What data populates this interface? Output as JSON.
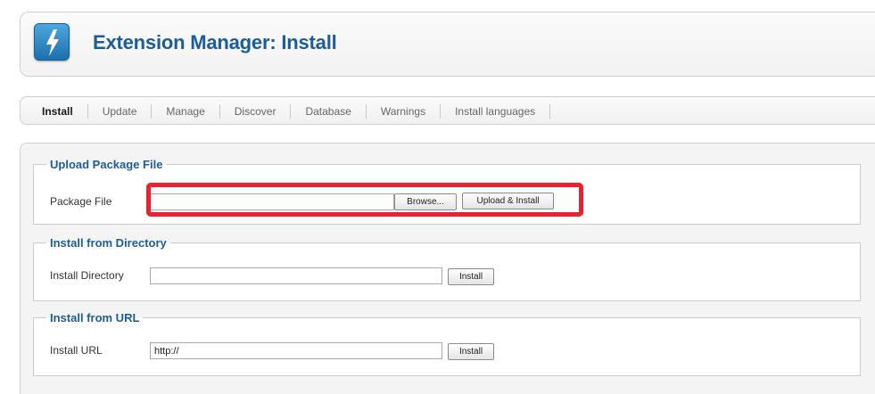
{
  "header": {
    "title": "Extension Manager: Install",
    "logo_icon": "lightning-icon",
    "logo_color": "#2b86c8"
  },
  "tabs": [
    {
      "label": "Install",
      "active": true
    },
    {
      "label": "Update",
      "active": false
    },
    {
      "label": "Manage",
      "active": false
    },
    {
      "label": "Discover",
      "active": false
    },
    {
      "label": "Database",
      "active": false
    },
    {
      "label": "Warnings",
      "active": false
    },
    {
      "label": "Install languages",
      "active": false
    }
  ],
  "upload": {
    "legend": "Upload Package File",
    "label": "Package File",
    "value": "",
    "browse_label": "Browse...",
    "submit_label": "Upload & Install",
    "highlight_color": "#e8232f"
  },
  "directory": {
    "legend": "Install from Directory",
    "label": "Install Directory",
    "value": "",
    "submit_label": "Install"
  },
  "url": {
    "legend": "Install from URL",
    "label": "Install URL",
    "value": "http://",
    "submit_label": "Install"
  }
}
